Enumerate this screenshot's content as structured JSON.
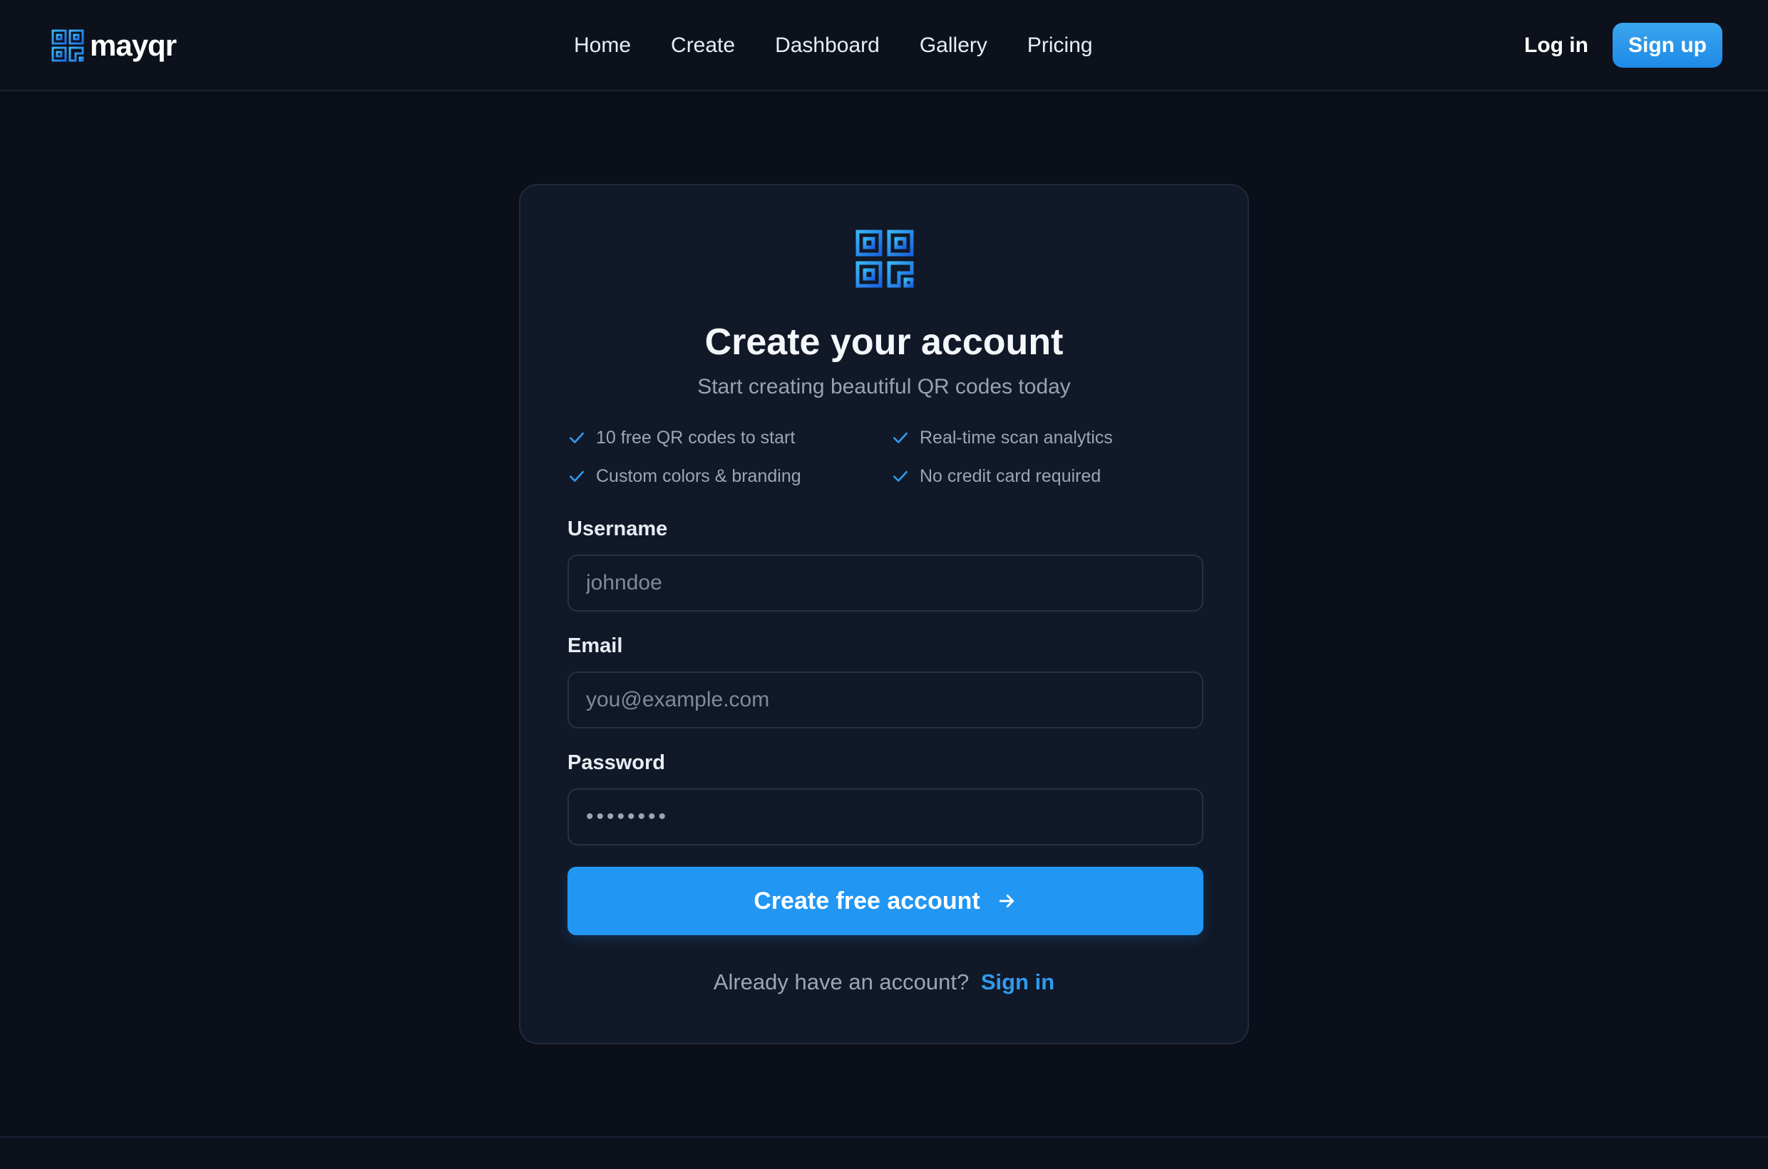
{
  "colors": {
    "accent": "#2196f3",
    "background": "#0b0f19",
    "card": "#111827",
    "link": "#2f9bef"
  },
  "header": {
    "brand": "mayqr",
    "nav": [
      "Home",
      "Create",
      "Dashboard",
      "Gallery",
      "Pricing"
    ],
    "login_label": "Log in",
    "signup_label": "Sign up"
  },
  "card": {
    "logo_icon": "qr-logo-icon",
    "title": "Create your account",
    "subtitle": "Start creating beautiful QR codes today",
    "features": [
      "10 free QR codes to start",
      "Real-time scan analytics",
      "Custom colors & branding",
      "No credit card required"
    ],
    "username": {
      "label": "Username",
      "placeholder": "johndoe"
    },
    "email": {
      "label": "Email",
      "placeholder": "you@example.com"
    },
    "password": {
      "label": "Password",
      "value": "••••••••"
    },
    "submit_label": "Create free account",
    "signin_prompt": "Already have an account?",
    "signin_link": "Sign in"
  }
}
